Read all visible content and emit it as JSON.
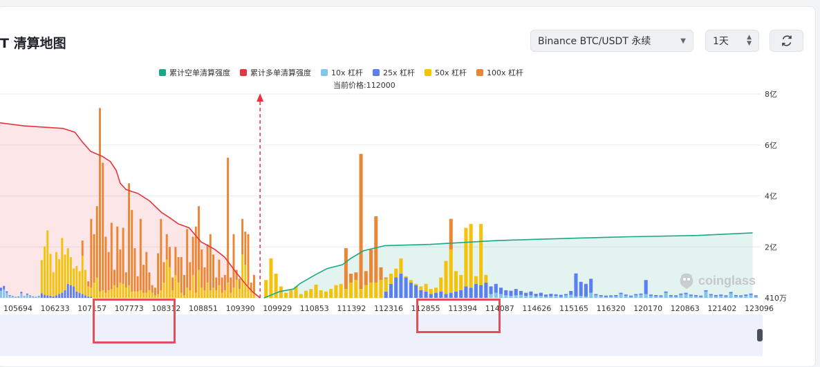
{
  "header": {
    "title": "T 清算地图",
    "exchange_select": "Binance BTC/USDT 永续",
    "period_select": "1天"
  },
  "legend": [
    {
      "label": "累计空单清算强度",
      "color": "#1aa785"
    },
    {
      "label": "累计多单清算强度",
      "color": "#e5343d"
    },
    {
      "label": "10x 杠杆",
      "color": "#86c5ea"
    },
    {
      "label": "25x 杠杆",
      "color": "#5b7ff0"
    },
    {
      "label": "50x 杠杆",
      "color": "#f5c20a"
    },
    {
      "label": "100x 杠杆",
      "color": "#eb8734"
    }
  ],
  "current_price_label": "当前价格:112000",
  "watermark": "coinglass",
  "chart_data": {
    "type": "bar",
    "current_price": 112000,
    "x_tick_labels": [
      "105694",
      "106233",
      "107157",
      "107773",
      "108312",
      "108851",
      "109390",
      "109929",
      "110853",
      "111392",
      "112316",
      "112855",
      "113394",
      "114087",
      "114626",
      "115165",
      "116320",
      "120170",
      "120863",
      "121402",
      "123096"
    ],
    "y_tick_labels": [
      "8亿",
      "6亿",
      "4亿",
      "2亿",
      "410万"
    ],
    "ylim": [
      0,
      800000000
    ],
    "bars_left": [
      [
        0.28,
        0.12,
        0,
        0
      ],
      [
        0.33,
        0.14,
        0,
        0
      ],
      [
        0.2,
        0.06,
        0,
        0
      ],
      [
        0.08,
        0.03,
        0,
        0
      ],
      [
        0.06,
        0.02,
        0,
        0
      ],
      [
        0.02,
        0.02,
        0,
        0
      ],
      [
        0.04,
        0.02,
        0,
        0
      ],
      [
        0.18,
        0.06,
        0,
        0
      ],
      [
        0.05,
        0.02,
        0,
        0
      ],
      [
        0.12,
        0.05,
        0,
        0
      ],
      [
        0.07,
        0.03,
        0,
        0
      ],
      [
        0.04,
        0.02,
        0,
        0
      ],
      [
        0.02,
        0.02,
        0,
        0
      ],
      [
        0.06,
        0.02,
        0,
        0
      ],
      [
        0,
        0.18,
        1.3,
        0
      ],
      [
        0,
        0.12,
        1.9,
        0
      ],
      [
        0,
        0.1,
        2.55,
        0
      ],
      [
        0,
        0.08,
        1.65,
        0
      ],
      [
        0,
        0.06,
        0.95,
        0
      ],
      [
        0,
        0.1,
        1.7,
        0
      ],
      [
        0,
        0.15,
        1.37,
        0
      ],
      [
        0,
        0.2,
        2.15,
        0
      ],
      [
        0,
        0.3,
        1.4,
        0
      ],
      [
        0,
        0.55,
        1.4,
        0
      ],
      [
        0,
        0.5,
        1.1,
        0
      ],
      [
        0,
        0.45,
        0.7,
        0
      ],
      [
        0,
        0.25,
        1.0,
        0
      ],
      [
        0,
        0.2,
        0.85,
        0
      ],
      [
        0,
        0.15,
        1.5,
        0.6
      ],
      [
        0,
        0.1,
        1.0,
        0
      ],
      [
        0,
        0.05,
        0.4,
        0.2
      ],
      [
        0,
        0.05,
        0.35,
        2.7
      ],
      [
        0,
        0,
        0.6,
        1.9
      ],
      [
        0,
        0,
        0.8,
        2.8
      ],
      [
        0,
        0,
        0.25,
        7.2
      ],
      [
        0,
        0,
        0.3,
        5.0
      ],
      [
        0,
        0,
        0.2,
        2.2
      ],
      [
        0,
        0,
        0.3,
        1.5
      ],
      [
        0,
        0,
        0.35,
        2.6
      ],
      [
        0,
        0,
        0.5,
        0.6
      ],
      [
        0,
        0,
        0.4,
        2.4
      ],
      [
        0,
        0,
        0.6,
        1.3
      ],
      [
        0,
        0,
        0.55,
        2.2
      ],
      [
        0,
        0,
        0.4,
        0.6
      ],
      [
        0,
        0,
        0.5,
        4.0
      ],
      [
        0,
        0,
        0.25,
        3.2
      ],
      [
        0,
        0,
        0.25,
        1.7
      ],
      [
        0,
        0,
        0.25,
        0.6
      ],
      [
        0,
        0,
        0.3,
        2.8
      ],
      [
        0,
        0,
        0.2,
        1.1
      ],
      [
        0,
        0,
        0.2,
        1.6
      ],
      [
        0,
        0,
        0.3,
        0.7
      ],
      [
        0,
        0,
        0.2,
        0.3
      ],
      [
        0,
        0,
        0.1,
        0.3
      ],
      [
        0,
        0,
        0.15,
        1.6
      ],
      [
        0,
        0,
        0.3,
        2.8
      ],
      [
        0,
        0,
        0.6,
        0.8
      ],
      [
        0,
        0,
        1.5,
        1.0
      ],
      [
        0,
        0,
        1.2,
        0.8
      ],
      [
        0,
        0,
        0.3,
        0.5
      ],
      [
        0,
        0,
        0.9,
        1.1
      ],
      [
        0,
        0,
        0.6,
        1.0
      ],
      [
        0,
        0,
        0.2,
        1.4
      ],
      [
        0,
        0,
        0.1,
        0.8
      ],
      [
        0,
        0,
        0.4,
        2.3
      ],
      [
        0,
        0,
        0.3,
        1.1
      ],
      [
        0,
        0,
        0.9,
        1.5
      ],
      [
        0,
        0,
        0.2,
        2.6
      ],
      [
        0,
        0,
        1.1,
        2.5
      ],
      [
        0,
        0,
        0.4,
        1.5
      ],
      [
        0,
        0,
        0.3,
        0.9
      ],
      [
        0,
        0,
        0.6,
        1.5
      ],
      [
        0,
        0,
        0.3,
        2.2
      ],
      [
        0,
        0,
        0.4,
        1.3
      ],
      [
        0,
        0,
        0.3,
        0.5
      ],
      [
        0,
        0,
        0.5,
        1.0
      ],
      [
        0,
        0,
        0.2,
        0.6
      ],
      [
        0,
        0,
        0.3,
        0.6
      ],
      [
        0,
        0,
        0.6,
        4.9
      ],
      [
        0,
        0,
        0.2,
        0.6
      ],
      [
        0,
        0,
        0.4,
        2.1
      ],
      [
        0,
        0,
        0.7,
        0.4
      ],
      [
        0,
        0,
        0.35,
        0.4
      ],
      [
        0,
        0,
        1.7,
        1.4
      ],
      [
        0,
        0,
        1.3,
        1.3
      ],
      [
        0,
        0,
        0.5,
        2.0
      ],
      [
        0,
        0,
        0.3,
        0.3
      ],
      [
        0,
        0,
        0.2,
        0.7
      ]
    ],
    "bars_right": [
      [
        0,
        0,
        0.7,
        0
      ],
      [
        0,
        0,
        1.55,
        0
      ],
      [
        0,
        0,
        0.95,
        0
      ],
      [
        0,
        0,
        0.45,
        0
      ],
      [
        0,
        0,
        0.2,
        0
      ],
      [
        0,
        0,
        0.3,
        0
      ],
      [
        0,
        0,
        0.45,
        0
      ],
      [
        0,
        0,
        0.15,
        0
      ],
      [
        0,
        0,
        0.28,
        0
      ],
      [
        0,
        0,
        0.35,
        0
      ],
      [
        0,
        0,
        0.52,
        0
      ],
      [
        0,
        0,
        0.3,
        0
      ],
      [
        0,
        0,
        0.25,
        0
      ],
      [
        0,
        0,
        0.35,
        0
      ],
      [
        0,
        0,
        0.5,
        0
      ],
      [
        0,
        0,
        0.55,
        0
      ],
      [
        0,
        0,
        0.35,
        1.6
      ],
      [
        0,
        0,
        0.6,
        0.35
      ],
      [
        0,
        0,
        0.7,
        0.3
      ],
      [
        0,
        0,
        0.35,
        5.3
      ],
      [
        0,
        0,
        0.5,
        0.55
      ],
      [
        0,
        0,
        0.6,
        1.3
      ],
      [
        0,
        0,
        0.6,
        2.6
      ],
      [
        0,
        0,
        0.7,
        0.5
      ],
      [
        0,
        0.25,
        0.5,
        0.05
      ],
      [
        0,
        0.55,
        0.4,
        0
      ],
      [
        0,
        0.8,
        0.35,
        0
      ],
      [
        0,
        0.95,
        0.6,
        0
      ],
      [
        0,
        0.8,
        0.05,
        0
      ],
      [
        0,
        0.6,
        0.1,
        0
      ],
      [
        0,
        0.5,
        0.05,
        0
      ],
      [
        0,
        0.3,
        0.15,
        0
      ],
      [
        0,
        0.25,
        0.3,
        0
      ],
      [
        0,
        0.15,
        0.2,
        0
      ],
      [
        0,
        0.2,
        0.2,
        0
      ],
      [
        0,
        0.25,
        0.55,
        0
      ],
      [
        0,
        0.15,
        1.3,
        0
      ],
      [
        0,
        0.2,
        1.7,
        1.2
      ],
      [
        0,
        0.25,
        0.8,
        0
      ],
      [
        0,
        0.3,
        0.6,
        0
      ],
      [
        0,
        0.45,
        2.3,
        0
      ],
      [
        0,
        0.4,
        2.5,
        0
      ],
      [
        0,
        0.55,
        0.3,
        0
      ],
      [
        0,
        0.5,
        2.4,
        0
      ],
      [
        0,
        0.6,
        0.3,
        0
      ],
      [
        0.15,
        0.3,
        0,
        0
      ],
      [
        0.2,
        0.35,
        0,
        0
      ],
      [
        0.15,
        0.25,
        0,
        0
      ],
      [
        0.1,
        0.2,
        0,
        0
      ],
      [
        0.08,
        0.2,
        0,
        0
      ],
      [
        0.1,
        0.25,
        0,
        0
      ],
      [
        0.12,
        0.15,
        0,
        0
      ],
      [
        0.08,
        0.12,
        0,
        0
      ],
      [
        0.1,
        0.15,
        0,
        0
      ],
      [
        0.06,
        0.1,
        0,
        0
      ],
      [
        0.08,
        0.12,
        0,
        0
      ],
      [
        0.05,
        0.08,
        0,
        0
      ],
      [
        0.06,
        0.1,
        0,
        0
      ],
      [
        0.08,
        0.06,
        0,
        0
      ],
      [
        0.04,
        0.08,
        0,
        0
      ],
      [
        0.1,
        0.05,
        0,
        0
      ],
      [
        0.12,
        0.15,
        0,
        0
      ],
      [
        0.06,
        0.9,
        0,
        0
      ],
      [
        0.08,
        0.55,
        0,
        0
      ],
      [
        0.05,
        0.5,
        0,
        0
      ],
      [
        0.2,
        0.55,
        0,
        0
      ],
      [
        0.1,
        0.05,
        0,
        0
      ],
      [
        0.06,
        0.05,
        0,
        0
      ],
      [
        0.04,
        0.05,
        0,
        0
      ],
      [
        0.05,
        0.05,
        0,
        0
      ],
      [
        0.06,
        0.05,
        0,
        0
      ],
      [
        0.15,
        0.05,
        0,
        0
      ],
      [
        0.08,
        0.05,
        0,
        0
      ],
      [
        0.04,
        0.05,
        0,
        0
      ],
      [
        0.1,
        0.05,
        0,
        0
      ],
      [
        0.12,
        0.05,
        0,
        0
      ],
      [
        0.15,
        0.55,
        0,
        0
      ],
      [
        0.08,
        0.05,
        0,
        0
      ],
      [
        0.06,
        0.05,
        0,
        0
      ],
      [
        0.05,
        0.05,
        0,
        0
      ],
      [
        0.2,
        0.05,
        0,
        0
      ],
      [
        0.06,
        0.05,
        0,
        0
      ],
      [
        0.05,
        0.05,
        0,
        0
      ],
      [
        0.12,
        0.05,
        0,
        0
      ],
      [
        0.15,
        0.05,
        0,
        0
      ],
      [
        0.08,
        0.05,
        0,
        0
      ],
      [
        0.06,
        0.05,
        0,
        0
      ],
      [
        0.04,
        0.05,
        0,
        0
      ],
      [
        0.25,
        0.05,
        0,
        0
      ],
      [
        0.1,
        0.05,
        0,
        0
      ],
      [
        0.06,
        0.05,
        0,
        0
      ],
      [
        0.08,
        0.05,
        0,
        0
      ],
      [
        0.05,
        0.05,
        0,
        0
      ],
      [
        0.18,
        0.05,
        0,
        0
      ],
      [
        0.06,
        0.05,
        0,
        0
      ],
      [
        0.05,
        0.05,
        0,
        0
      ],
      [
        0.08,
        0.05,
        0,
        0
      ],
      [
        0.12,
        0.05,
        0,
        0
      ],
      [
        0.05,
        0.05,
        0,
        0
      ]
    ],
    "cumulative_long_yi": [
      [
        105000,
        6.95
      ],
      [
        105500,
        6.85
      ],
      [
        106000,
        6.75
      ],
      [
        106500,
        6.7
      ],
      [
        107000,
        6.65
      ],
      [
        107300,
        6.5
      ],
      [
        107500,
        6.1
      ],
      [
        107700,
        5.75
      ],
      [
        108000,
        5.55
      ],
      [
        108200,
        5.35
      ],
      [
        108350,
        5.0
      ],
      [
        108450,
        4.5
      ],
      [
        108600,
        4.25
      ],
      [
        108900,
        4.1
      ],
      [
        109200,
        3.8
      ],
      [
        109500,
        3.35
      ],
      [
        109700,
        3.15
      ],
      [
        109929,
        2.9
      ],
      [
        110200,
        2.75
      ],
      [
        110500,
        2.2
      ],
      [
        110853,
        1.9
      ],
      [
        111100,
        1.6
      ],
      [
        111392,
        1.0
      ],
      [
        111600,
        0.6
      ],
      [
        111800,
        0.25
      ],
      [
        112000,
        0
      ]
    ],
    "cumulative_short_yi": [
      [
        112100,
        0
      ],
      [
        112500,
        0.25
      ],
      [
        112855,
        0.35
      ],
      [
        113000,
        0.55
      ],
      [
        113394,
        0.9
      ],
      [
        113700,
        1.15
      ],
      [
        114087,
        1.3
      ],
      [
        114300,
        1.55
      ],
      [
        114626,
        1.85
      ],
      [
        115165,
        2.05
      ],
      [
        116320,
        2.1
      ],
      [
        118000,
        2.25
      ],
      [
        120170,
        2.35
      ],
      [
        121402,
        2.4
      ],
      [
        123096,
        2.45
      ],
      [
        124500,
        2.55
      ]
    ],
    "highlight_ranges": [
      [
        107773,
        108312
      ],
      [
        113394,
        114087
      ]
    ]
  }
}
